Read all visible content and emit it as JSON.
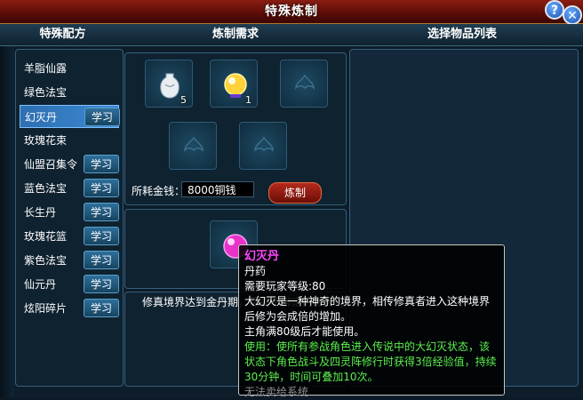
{
  "window": {
    "title": "特殊炼制"
  },
  "headers": {
    "recipes": "特殊配方",
    "requirements": "炼制需求",
    "select_list": "选择物品列表"
  },
  "recipes": [
    {
      "label": "羊脂仙露",
      "learn": false,
      "selected": false
    },
    {
      "label": "绿色法宝",
      "learn": false,
      "selected": false
    },
    {
      "label": "幻灭丹",
      "learn": true,
      "selected": true
    },
    {
      "label": "玫瑰花束",
      "learn": false,
      "selected": false
    },
    {
      "label": "仙盟召集令",
      "learn": true,
      "selected": false
    },
    {
      "label": "蓝色法宝",
      "learn": true,
      "selected": false
    },
    {
      "label": "长生丹",
      "learn": true,
      "selected": false
    },
    {
      "label": "玫瑰花篮",
      "learn": true,
      "selected": false
    },
    {
      "label": "紫色法宝",
      "learn": true,
      "selected": false
    },
    {
      "label": "仙元丹",
      "learn": true,
      "selected": false
    },
    {
      "label": "炫阳碎片",
      "learn": true,
      "selected": false
    }
  ],
  "learn_label": "学习",
  "materials": [
    {
      "icon": "white-vase-icon",
      "count": "5"
    },
    {
      "icon": "golden-orb-icon",
      "count": "1"
    },
    {
      "icon": "empty-slot-icon",
      "count": ""
    },
    {
      "icon": "empty-slot-icon",
      "count": ""
    },
    {
      "icon": "empty-slot-icon",
      "count": ""
    }
  ],
  "cost": {
    "label": "所耗金钱：",
    "value": "8000铜钱"
  },
  "craft_button": "炼制",
  "result": {
    "icon": "pink-pill-icon"
  },
  "description": "修真境界达到金丹期，需要不绑定的寂灭丹",
  "tooltip": {
    "name": "幻灭丹",
    "type": "丹药",
    "level": "需要玩家等级:80",
    "desc1": "大幻灭是一种神奇的境界，相传修真者进入这种境界后修为会成倍的增加。",
    "desc2": "主角满80级后才能使用。",
    "use": "使用：使所有参战角色进入传说中的大幻灭状态，该状态下角色战斗及四灵阵修行时获得3倍经验值，持续30分钟，时间可叠加10次。",
    "footer": "无法卖给系统"
  },
  "colors": {
    "accent": "#b52a1c",
    "tooltip_title": "#ff44ff",
    "use_text": "#5cf04c"
  }
}
